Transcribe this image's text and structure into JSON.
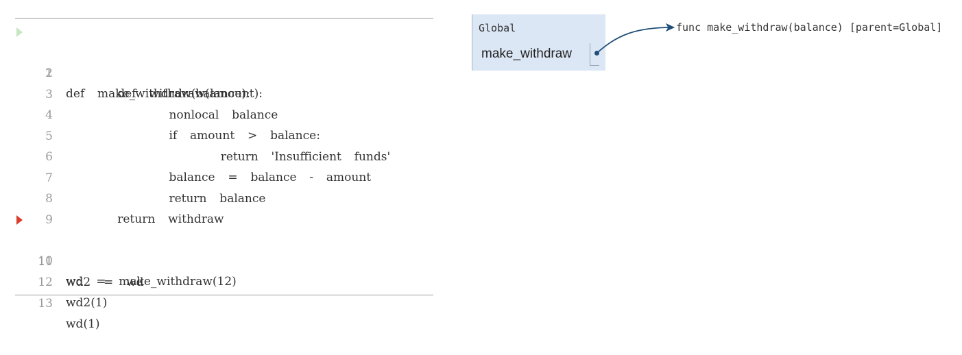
{
  "code": {
    "lines": [
      {
        "num": "1",
        "text": "def  make_withdraw(balance):"
      },
      {
        "num": "2",
        "text": "        def  withdraw(amount):"
      },
      {
        "num": "3",
        "text": "                nonlocal  balance"
      },
      {
        "num": "4",
        "text": "                if  amount  >  balance:"
      },
      {
        "num": "5",
        "text": "                        return  'Insufficient  funds'"
      },
      {
        "num": "6",
        "text": "                balance  =  balance  -  amount"
      },
      {
        "num": "7",
        "text": "                return  balance"
      },
      {
        "num": "8",
        "text": "        return  withdraw"
      },
      {
        "num": "9",
        "text": ""
      },
      {
        "num": "10",
        "text": "wd  =  make_withdraw(12)"
      },
      {
        "num": "11",
        "text": "wd2  =  wd"
      },
      {
        "num": "12",
        "text": "wd2(1)"
      },
      {
        "num": "13",
        "text": "wd(1)"
      }
    ],
    "prev_line_arrow_color": "#c7e6c1",
    "next_line_arrow_color": "#d9402f"
  },
  "frames": {
    "global": {
      "title": "Global",
      "variables": [
        {
          "name": "make_withdraw"
        }
      ],
      "background": "#dce7f6"
    }
  },
  "objects": {
    "func_label": "func make_withdraw(balance) [parent=Global]"
  },
  "pointer_color": "#1f4e79"
}
